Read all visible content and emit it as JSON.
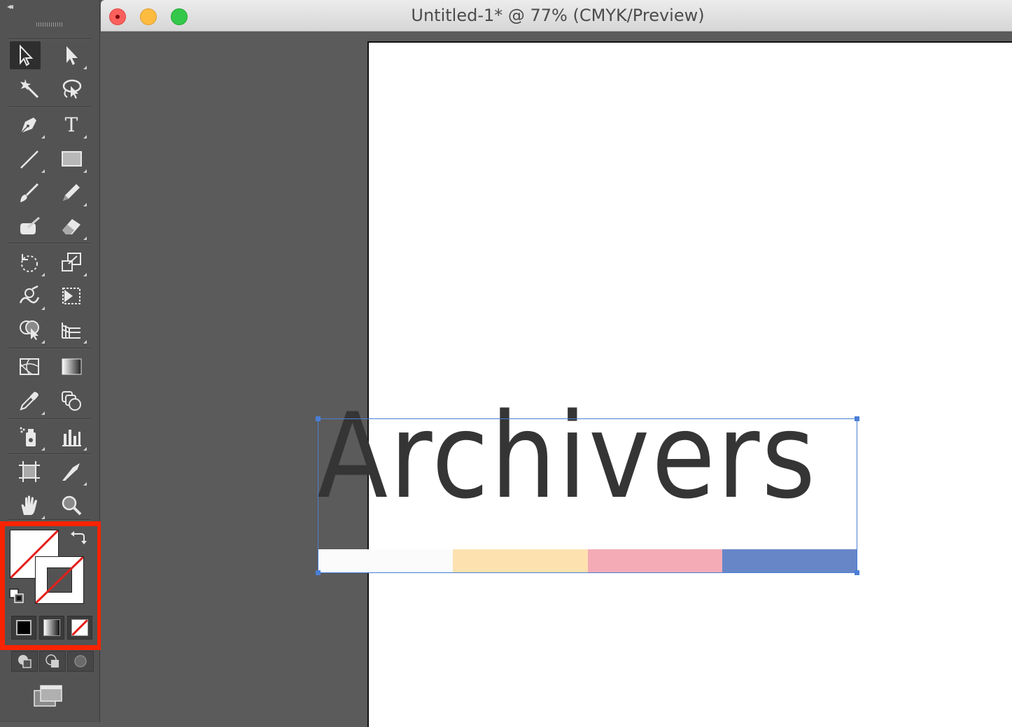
{
  "window": {
    "title": "Untitled-1* @ 77% (CMYK/Preview)",
    "traffic_lights": [
      "close",
      "minimize",
      "maximize"
    ]
  },
  "tools_panel": {
    "collapse_glyph": "◂◂",
    "tools": [
      {
        "name": "selection-tool",
        "icon": "selection-arrow-icon",
        "selected": true
      },
      {
        "name": "direct-selection-tool",
        "icon": "direct-selection-arrow-icon"
      },
      {
        "name": "magic-wand-tool",
        "icon": "magic-wand-icon"
      },
      {
        "name": "lasso-tool",
        "icon": "lasso-icon"
      },
      {
        "name": "pen-tool",
        "icon": "pen-icon"
      },
      {
        "name": "type-tool",
        "icon": "type-icon",
        "label": "T"
      },
      {
        "name": "line-segment-tool",
        "icon": "line-icon"
      },
      {
        "name": "rectangle-tool",
        "icon": "rectangle-icon"
      },
      {
        "name": "paintbrush-tool",
        "icon": "paintbrush-icon"
      },
      {
        "name": "pencil-tool",
        "icon": "pencil-icon"
      },
      {
        "name": "blob-brush-tool",
        "icon": "blob-brush-icon"
      },
      {
        "name": "eraser-tool",
        "icon": "eraser-icon"
      },
      {
        "name": "rotate-tool",
        "icon": "rotate-icon"
      },
      {
        "name": "scale-tool",
        "icon": "scale-icon"
      },
      {
        "name": "warp-tool",
        "icon": "warp-icon"
      },
      {
        "name": "free-transform-tool",
        "icon": "free-transform-icon"
      },
      {
        "name": "shape-builder-tool",
        "icon": "shape-builder-icon"
      },
      {
        "name": "perspective-grid-tool",
        "icon": "perspective-grid-icon"
      },
      {
        "name": "mesh-tool",
        "icon": "mesh-icon"
      },
      {
        "name": "gradient-tool",
        "icon": "gradient-icon"
      },
      {
        "name": "eyedropper-tool",
        "icon": "eyedropper-icon"
      },
      {
        "name": "blend-tool",
        "icon": "blend-icon"
      },
      {
        "name": "symbol-sprayer-tool",
        "icon": "symbol-sprayer-icon"
      },
      {
        "name": "column-graph-tool",
        "icon": "column-graph-icon"
      },
      {
        "name": "artboard-tool",
        "icon": "artboard-icon"
      },
      {
        "name": "slice-tool",
        "icon": "slice-icon"
      },
      {
        "name": "hand-tool",
        "icon": "hand-icon"
      },
      {
        "name": "zoom-tool",
        "icon": "zoom-icon"
      }
    ],
    "fill_color": "none",
    "stroke_color": "none",
    "highlight_color": "#f92300",
    "color_modes": [
      "color",
      "gradient",
      "none"
    ],
    "draw_modes": [
      "draw-normal",
      "draw-behind",
      "draw-inside"
    ]
  },
  "artwork": {
    "text": "Archivers",
    "text_color": "#353535",
    "color_bars": [
      "#fbfbfb",
      "#fde2b0",
      "#f4abb6",
      "#6786c8"
    ],
    "selection_color": "#4a7fd6"
  }
}
